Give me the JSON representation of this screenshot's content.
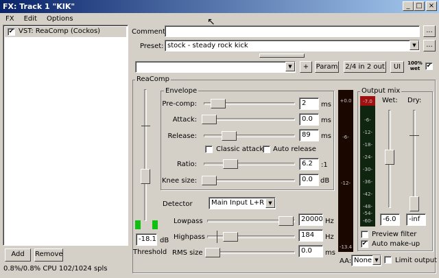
{
  "window": {
    "title": "FX: Track 1 \"KIK\"",
    "minimize": "_",
    "maximize": "□",
    "close": "×"
  },
  "menu": [
    "FX",
    "Edit",
    "Options"
  ],
  "fx_list": {
    "items": [
      {
        "label": "VST: ReaComp (Cockos)",
        "checked": true
      }
    ]
  },
  "bottom": {
    "add": "Add",
    "remove": "Remove",
    "cpu": "0.8%/0.8% CPU 102/1024 spls"
  },
  "header": {
    "comment_label": "Comment:",
    "comment_value": "",
    "comment_btn": "...",
    "preset_label": "Preset:",
    "preset_value": "stock - steady rock kick",
    "preset_btn": "...",
    "param_value": "",
    "plus": "+",
    "param": "Param",
    "io": "2/4 in 2 out",
    "ui": "UI",
    "wet_pct": "100%",
    "wet_word": "wet"
  },
  "reacomp": {
    "title": "ReaComp",
    "threshold": {
      "value": "-18.1",
      "unit": "dB",
      "label": "Threshold"
    },
    "envelope": {
      "title": "Envelope",
      "precomp": {
        "label": "Pre-comp:",
        "value": "2",
        "unit": "ms"
      },
      "attack": {
        "label": "Attack:",
        "value": "0.0",
        "unit": "ms"
      },
      "release": {
        "label": "Release:",
        "value": "89",
        "unit": "ms"
      },
      "classic_attack": "Classic attack",
      "auto_release": "Auto release",
      "ratio": {
        "label": "Ratio:",
        "value": "6.2",
        "unit": ":1"
      },
      "knee": {
        "label": "Knee size:",
        "value": "0.0",
        "unit": "dB"
      }
    },
    "detector": {
      "label": "Detector",
      "value": "Main Input L+R"
    },
    "lowpass": {
      "label": "Lowpass",
      "value": "20000",
      "unit": "Hz"
    },
    "highpass": {
      "label": "Highpass",
      "value": "184",
      "unit": "Hz"
    },
    "rms": {
      "label": "RMS size",
      "value": "0.0",
      "unit": "ms"
    },
    "meter_in": {
      "top": "+0.0",
      "ticks": [
        "-6-",
        "-12-"
      ],
      "bottom": "-13.4"
    },
    "output_mix": {
      "title": "Output mix",
      "gr_top": "-7.0",
      "gr_ticks": [
        "-6-",
        "-12-",
        "-18-",
        "-24-",
        "-30-",
        "-36-",
        "-42-",
        "-48-",
        "-54-",
        "-60-"
      ],
      "wet_label": "Wet:",
      "dry_label": "Dry:",
      "wet_value": "-6.0",
      "dry_value": "-inf",
      "preview_filter": "Preview filter",
      "auto_makeup": "Auto make-up"
    },
    "aa": {
      "label": "AA:",
      "value": "None"
    },
    "limit_output": "Limit output"
  }
}
